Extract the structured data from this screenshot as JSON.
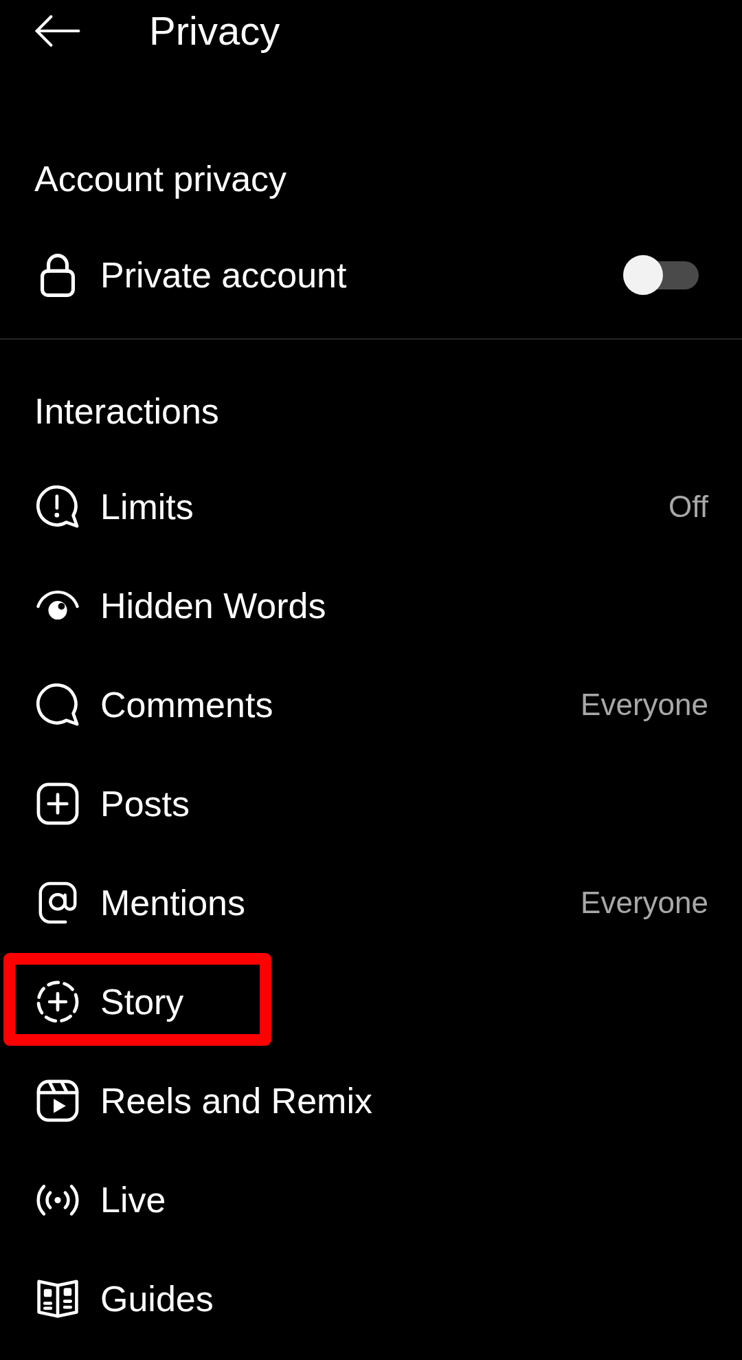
{
  "header": {
    "title": "Privacy"
  },
  "account_privacy": {
    "heading": "Account privacy",
    "items": [
      {
        "label": "Private account",
        "on": false
      }
    ]
  },
  "interactions": {
    "heading": "Interactions",
    "items": [
      {
        "label": "Limits",
        "value": "Off",
        "highlighted": false
      },
      {
        "label": "Hidden Words",
        "highlighted": false
      },
      {
        "label": "Comments",
        "value": "Everyone",
        "highlighted": false
      },
      {
        "label": "Posts",
        "highlighted": false
      },
      {
        "label": "Mentions",
        "value": "Everyone",
        "highlighted": false
      },
      {
        "label": "Story",
        "highlighted": true
      },
      {
        "label": "Reels and Remix",
        "highlighted": false
      },
      {
        "label": "Live",
        "highlighted": false
      },
      {
        "label": "Guides",
        "highlighted": false
      }
    ]
  }
}
